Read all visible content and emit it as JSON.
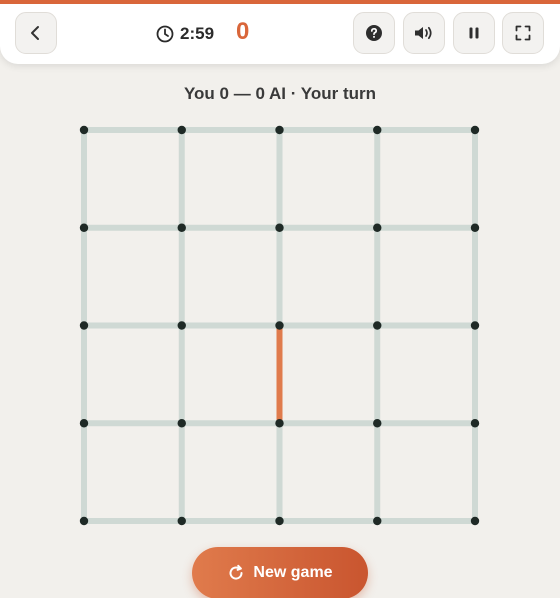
{
  "header": {
    "timer": "2:59",
    "score": "0",
    "icons": [
      "back-icon",
      "clock-icon",
      "help-icon",
      "sound-icon",
      "pause-icon",
      "fullscreen-icon"
    ]
  },
  "status": "You 0 — 0 AI · Your turn",
  "board": {
    "cols": 5,
    "rows": 4,
    "drawn_lines": [
      {
        "orientation": "vertical",
        "row": 2,
        "col": 2,
        "owner": "player"
      }
    ]
  },
  "new_game": {
    "label": "New game"
  },
  "colors": {
    "accent": "#d9663a",
    "line_empty": "#cfd9d4",
    "line_player": "#e07b4c",
    "dot": "#1f2a26"
  }
}
